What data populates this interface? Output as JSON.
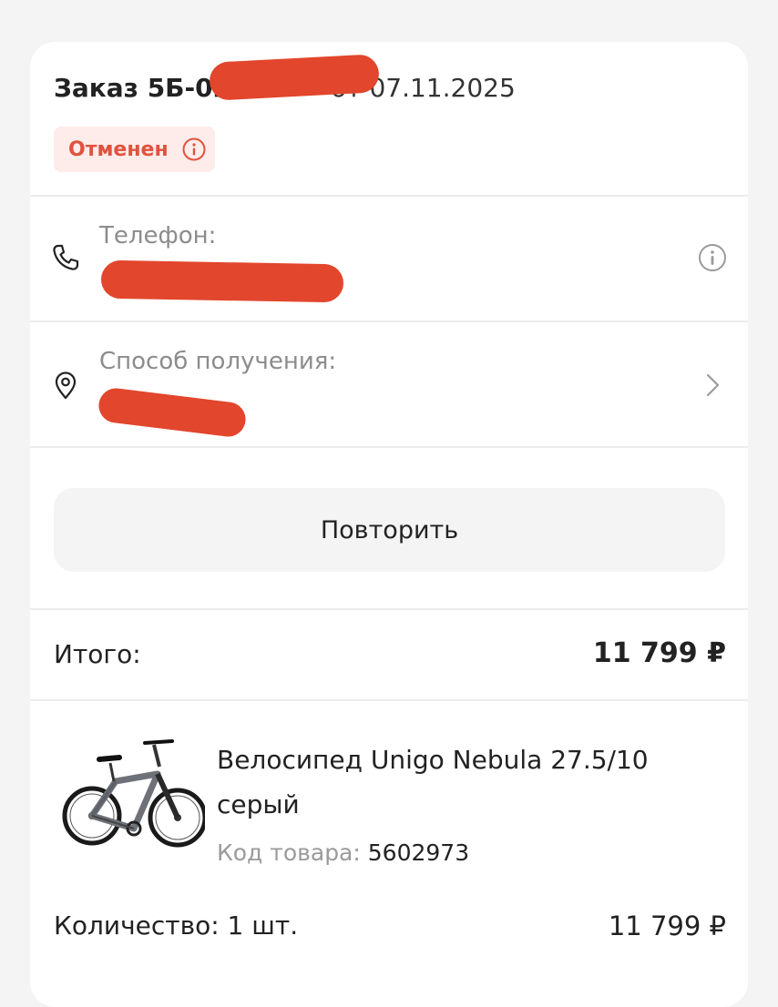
{
  "order": {
    "title_prefix": "Заказ 5Б-02",
    "title_date": "от 07.11.2025",
    "status": "Отменен"
  },
  "contact": {
    "phone_label": "Телефон:"
  },
  "delivery": {
    "method_label": "Способ получения:"
  },
  "actions": {
    "repeat_label": "Повторить"
  },
  "summary": {
    "total_label": "Итого:",
    "total_value": "11 799 ₽"
  },
  "product": {
    "name": "Велосипед Unigo Nebula 27.5/10 серый",
    "code_label": "Код товара:",
    "code_value": "5602973",
    "quantity_text": "Количество: 1 шт.",
    "price": "11 799 ₽",
    "image_icon": "bicycle-image"
  },
  "colors": {
    "status_text": "#e0523e",
    "status_bg": "#fdecea",
    "redaction": "#e2462c"
  },
  "icons": {
    "status_info": "info-icon",
    "phone": "phone-icon",
    "phone_info": "info-icon",
    "location": "location-pin-icon",
    "chevron": "chevron-right-icon"
  }
}
